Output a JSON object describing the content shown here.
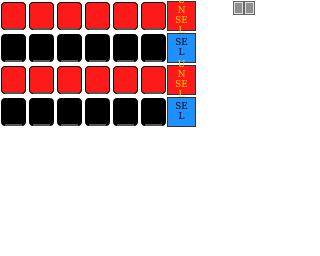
{
  "board": {
    "rows": [
      {
        "color": "#ff1a1a",
        "button": {
          "label": "UNSEL",
          "text_color": "#ffd400",
          "bg": "#ff1a1a"
        }
      },
      {
        "color": "#000000",
        "button": {
          "label": "SEL",
          "text_color": "#000000",
          "bg": "#1e90ff"
        }
      },
      {
        "color": "#ff1a1a",
        "button": {
          "label": "UNSEL",
          "text_color": "#ffd400",
          "bg": "#ff1a1a"
        }
      },
      {
        "color": "#000000",
        "button": {
          "label": "SEL",
          "text_color": "#000000",
          "bg": "#1e90ff"
        }
      }
    ],
    "columns": 6
  },
  "toolbar": {
    "icon": "book-icon"
  }
}
